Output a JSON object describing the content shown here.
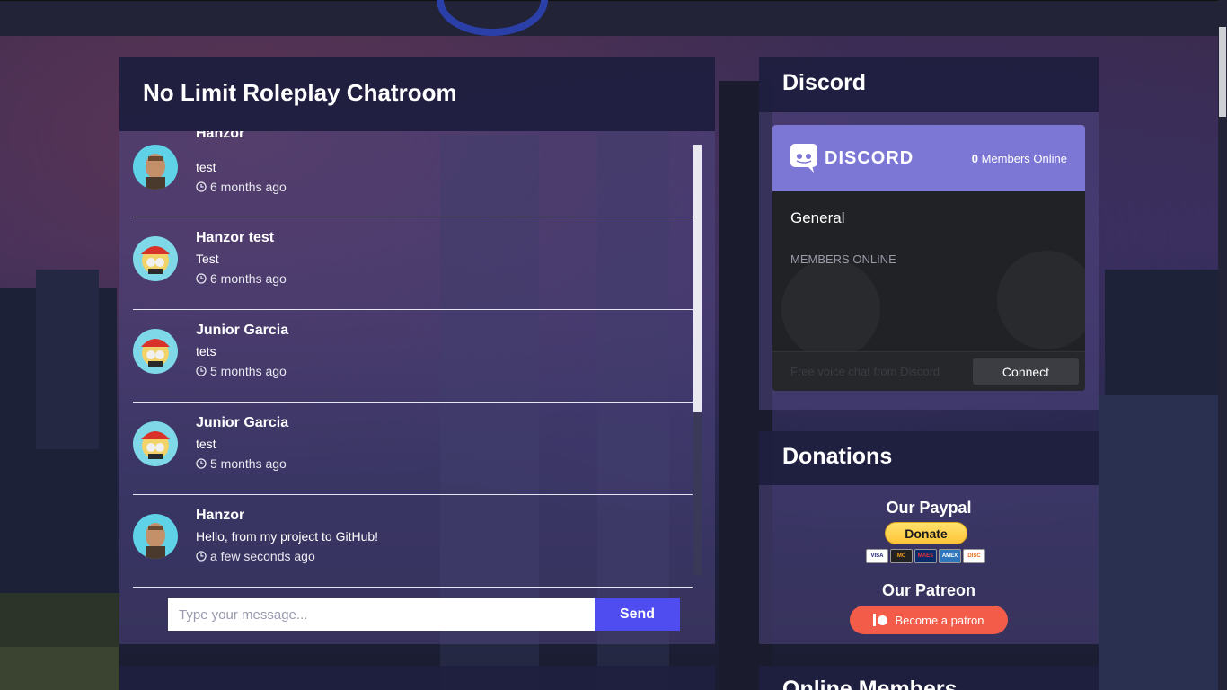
{
  "chat": {
    "title": "No Limit Roleplay Chatroom",
    "messages": [
      {
        "name": "Hanzor",
        "text": "test",
        "time": "6 months ago",
        "avatar": "trevor-avatar"
      },
      {
        "name": "Hanzor test",
        "text": "Test",
        "time": "6 months ago",
        "avatar": "masked-avatar"
      },
      {
        "name": "Junior Garcia",
        "text": "tets",
        "time": "5 months ago",
        "avatar": "masked-avatar"
      },
      {
        "name": "Junior Garcia",
        "text": "test",
        "time": "5 months ago",
        "avatar": "masked-avatar"
      },
      {
        "name": "Hanzor",
        "text": "Hello, from my project to GitHub!",
        "time": "a few seconds ago",
        "avatar": "trevor-avatar"
      }
    ],
    "input_placeholder": "Type your message...",
    "send_label": "Send"
  },
  "discord": {
    "title": "Discord",
    "brand": "DISCORD",
    "members_count": "0",
    "members_label": "Members Online",
    "channel": "General",
    "members_online_heading": "MEMBERS ONLINE",
    "footer_text": "Free voice chat from Discord",
    "connect_label": "Connect",
    "accent": "#7c77d5"
  },
  "donations": {
    "title": "Donations",
    "paypal_heading": "Our Paypal",
    "donate_label": "Donate",
    "cards": [
      "VISA",
      "MC",
      "MAES",
      "AMEX",
      "DISC"
    ],
    "patreon_heading": "Our Patreon",
    "patreon_label": "Become a patron",
    "patreon_color": "#f25c48"
  },
  "online_members": {
    "title": "Online Members"
  }
}
